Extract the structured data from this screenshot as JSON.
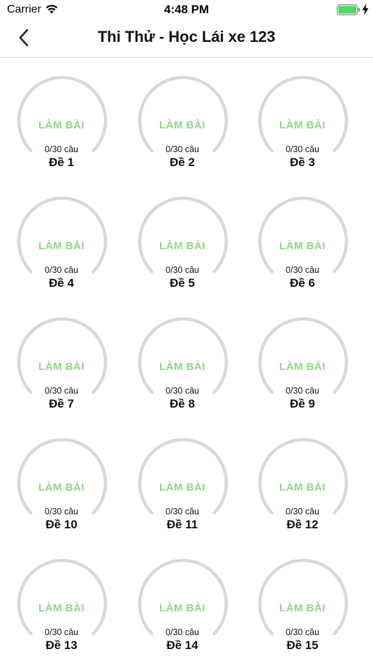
{
  "status_bar": {
    "carrier": "Carrier",
    "time": "4:48 PM",
    "wifi_icon": "wifi-icon",
    "battery_icon": "battery-icon",
    "charging_icon": "bolt-icon",
    "battery_color": "#4cd964"
  },
  "nav": {
    "back_icon": "chevron-left-icon",
    "title": "Thi Thử - Học Lái xe 123"
  },
  "colors": {
    "accent_green": "#8fd586",
    "ring_gray": "#d8d8d8"
  },
  "exams": [
    {
      "start_label": "LÀM BÀI",
      "progress": "0/30 câu",
      "name": "Đề 1"
    },
    {
      "start_label": "LÀM BÀI",
      "progress": "0/30 câu",
      "name": "Đề 2"
    },
    {
      "start_label": "LÀM BÀI",
      "progress": "0/30 câu",
      "name": "Đề 3"
    },
    {
      "start_label": "LÀM BÀI",
      "progress": "0/30 câu",
      "name": "Đề 4"
    },
    {
      "start_label": "LÀM BÀI",
      "progress": "0/30 câu",
      "name": "Đề 5"
    },
    {
      "start_label": "LÀM BÀI",
      "progress": "0/30 câu",
      "name": "Đề 6"
    },
    {
      "start_label": "LÀM BÀI",
      "progress": "0/30 câu",
      "name": "Đề 7"
    },
    {
      "start_label": "LÀM BÀI",
      "progress": "0/30 câu",
      "name": "Đề 8"
    },
    {
      "start_label": "LÀM BÀI",
      "progress": "0/30 câu",
      "name": "Đề 9"
    },
    {
      "start_label": "LÀM BÀI",
      "progress": "0/30 câu",
      "name": "Đề 10"
    },
    {
      "start_label": "LÀM BÀI",
      "progress": "0/30 câu",
      "name": "Đề 11"
    },
    {
      "start_label": "LÀM BÀI",
      "progress": "0/30 câu",
      "name": "Đề 12"
    },
    {
      "start_label": "LÀM BÀI",
      "progress": "0/30 câu",
      "name": "Đề 13"
    },
    {
      "start_label": "LÀM BÀI",
      "progress": "0/30 câu",
      "name": "Đề 14"
    },
    {
      "start_label": "LÀM BÀI",
      "progress": "0/30 câu",
      "name": "Đề 15"
    }
  ]
}
